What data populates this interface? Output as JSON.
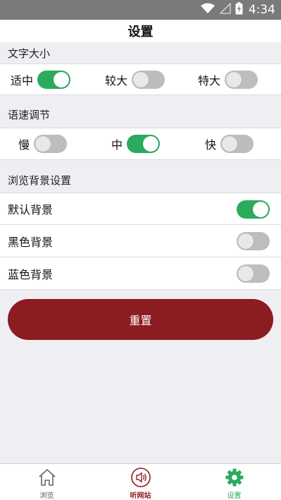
{
  "status": {
    "time": "4:34"
  },
  "header": {
    "title": "设置"
  },
  "font_size": {
    "title": "文字大小",
    "options": [
      {
        "label": "适中",
        "on": true
      },
      {
        "label": "较大",
        "on": false
      },
      {
        "label": "特大",
        "on": false
      }
    ]
  },
  "speed": {
    "title": "语速调节",
    "options": [
      {
        "label": "慢",
        "on": false
      },
      {
        "label": "中",
        "on": true
      },
      {
        "label": "快",
        "on": false
      }
    ]
  },
  "background": {
    "title": "浏览背景设置",
    "options": [
      {
        "label": "默认背景",
        "on": true
      },
      {
        "label": "黑色背景",
        "on": false
      },
      {
        "label": "蓝色背景",
        "on": false
      }
    ]
  },
  "reset_label": "重置",
  "nav": {
    "items": [
      {
        "label": "浏览",
        "icon": "home-icon"
      },
      {
        "label": "听网站",
        "icon": "speaker-icon"
      },
      {
        "label": "设置",
        "icon": "gear-icon"
      }
    ]
  },
  "colors": {
    "accent": "#8b1c22",
    "switch_on": "#2bab5c",
    "switch_off": "#bdbdbd"
  }
}
